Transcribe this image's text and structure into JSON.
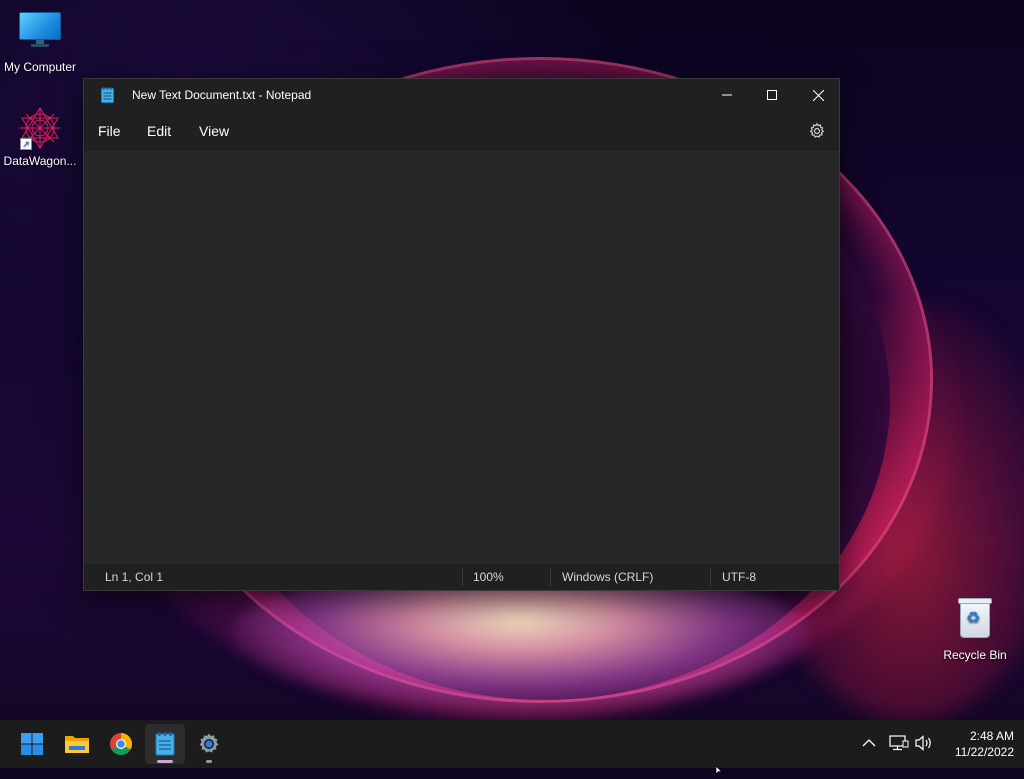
{
  "desktop": {
    "icons": [
      {
        "label": "My Computer"
      },
      {
        "label": "DataWagon..."
      },
      {
        "label": "Recycle Bin"
      }
    ]
  },
  "notepad": {
    "title": "New Text Document.txt - Notepad",
    "menu": [
      "File",
      "Edit",
      "View"
    ],
    "content": "",
    "status": {
      "position": "Ln 1, Col 1",
      "zoom": "100%",
      "line_ending": "Windows (CRLF)",
      "encoding": "UTF-8"
    }
  },
  "taskbar": {
    "apps": [
      "start-icon",
      "file-explorer-icon",
      "chrome-icon",
      "notepad-icon",
      "settings-icon"
    ],
    "clock": {
      "time": "2:48 AM",
      "date": "11/22/2022"
    }
  },
  "colors": {
    "window_bg": "#272727",
    "titlebar_bg": "#202020",
    "taskbar_bg": "#1c1c1c",
    "accent": "#0a84ff"
  }
}
